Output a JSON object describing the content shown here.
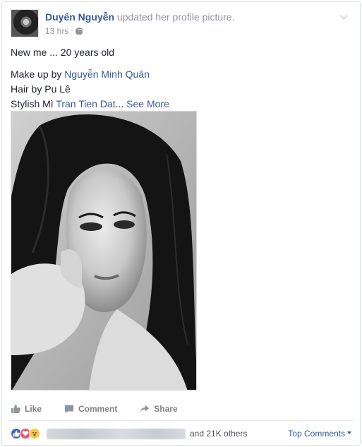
{
  "post": {
    "author": "Duyên Nguyễn",
    "action": "updated her profile picture.",
    "time": "13 hrs",
    "separator": "·",
    "privacy_icon": "globe-icon",
    "menu_icon": "chevron-down-icon"
  },
  "content": {
    "line1": "New me ... 20 years old",
    "makeup_prefix": "Make up by ",
    "makeup_link": "Nguyễn Minh Quân",
    "hair_line": "Hair by Pu Lê",
    "stylist_prefix": "Stylish Mì ",
    "stylist_link": "Tran Tien Dat",
    "ellipsis": "...",
    "see_more": "See More"
  },
  "actions": {
    "like": "Like",
    "comment": "Comment",
    "share": "Share"
  },
  "reactions": {
    "icons": [
      "like-reaction-icon",
      "love-reaction-icon",
      "wow-reaction-icon"
    ],
    "others": "and 21K others",
    "top_comments": "Top Comments"
  },
  "colors": {
    "link": "#365899",
    "muted": "#90949c",
    "like_blue": "#4267b2",
    "love_red": "#f25268",
    "wow_yellow": "#f7c948"
  }
}
